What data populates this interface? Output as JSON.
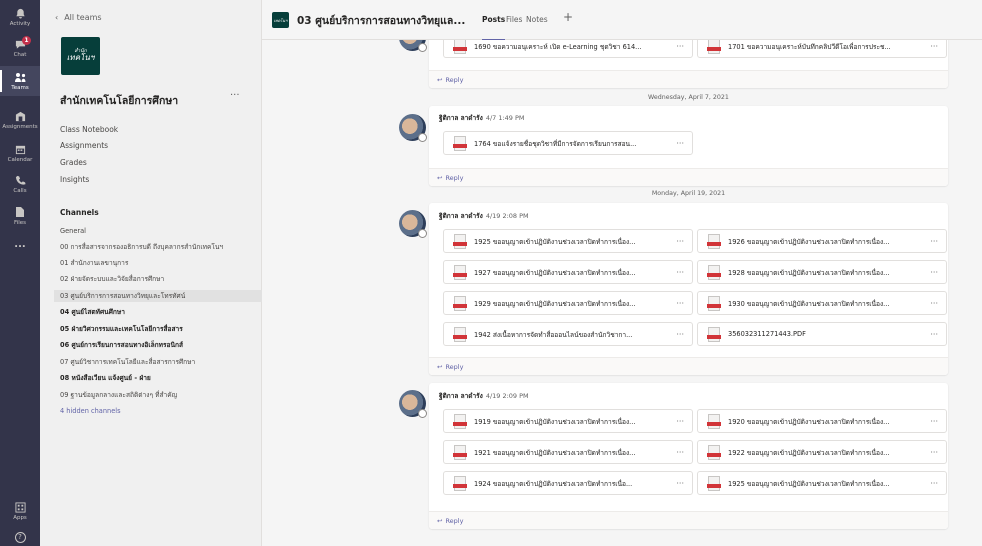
{
  "rail": [
    {
      "label": "Activity",
      "icon": "bell-icon"
    },
    {
      "label": "Chat",
      "icon": "chat-icon",
      "badge": "1"
    },
    {
      "label": "Teams",
      "icon": "teams-icon",
      "active": true
    },
    {
      "label": "Assignments",
      "icon": "assignments-icon"
    },
    {
      "label": "Calendar",
      "icon": "calendar-icon"
    },
    {
      "label": "Calls",
      "icon": "phone-icon"
    },
    {
      "label": "Files",
      "icon": "file-icon"
    },
    {
      "label": "...",
      "icon": "more-icon"
    },
    {
      "label": "Apps",
      "icon": "apps-icon"
    },
    {
      "label": "?",
      "icon": "help-icon"
    }
  ],
  "panel": {
    "back_label": "All teams",
    "logo_line1": "สำนัก",
    "logo_line2": "เทคโนฯ",
    "team_name": "สำนักเทคโนโลยีการศึกษา",
    "team_more": "···",
    "links": [
      "Class Notebook",
      "Assignments",
      "Grades",
      "Insights"
    ],
    "channels_heading": "Channels",
    "channels": [
      {
        "label": "General"
      },
      {
        "label": "00 การสื่อสารจากรองอธิการบดี ถึงบุคลากรสำนักเทคโนฯ"
      },
      {
        "label": "01 สำนักงานเลขานุการ"
      },
      {
        "label": "02 ฝ่ายจัดระบบและวิจัยสื่อการศึกษา"
      },
      {
        "label": "03 ศูนย์บริการการสอนทางวิทยุและโทรทัศน์",
        "selected": true
      },
      {
        "label": "04 ศูนย์ไสตทัศนศึกษา",
        "bold": true
      },
      {
        "label": "05 ฝ่ายวิศวกรรมและเทคโนโลยีการสื่อสาร",
        "bold": true
      },
      {
        "label": "06 ศูนย์การเรียนการสอนทางอิเล็กทรอนิกส์",
        "bold": true
      },
      {
        "label": "07 ศูนย์วิชาการเทคโนโลยีและสื่อสารการศึกษา"
      },
      {
        "label": "08 หนังสือเวียน แจ้งศูนย์ - ฝ่าย",
        "bold": true
      },
      {
        "label": "09 ฐานข้อมูลกลางและสถิติต่างๆ ที่สำคัญ"
      }
    ],
    "hidden_channels": "4 hidden channels"
  },
  "header": {
    "channel_icon_text": "เทคโนฯ",
    "title": "03 ศูนย์บริการการสอนทางวิทยุแล...",
    "tabs": [
      "Posts",
      "Files",
      "Notes"
    ],
    "add_tab": "+"
  },
  "feed": {
    "reply_label": "Reply",
    "top_files": [
      "1690 ขอความอนุเคราะห์ เปิด e-Learning ชุดวิชา 614...",
      "1701 ขอความอนุเคราะห์บันทึกคลิปวีดีโอเพื่อการประช..."
    ],
    "date1": "Wednesday, April 7, 2021",
    "post1": {
      "author": "ฐิติกาล ลาดำรัง",
      "time": "4/7 1:49 PM",
      "files": [
        "1764 ขอแจ้งรายชื่อชุดวิชาที่มีการจัดการเรียนการสอน..."
      ]
    },
    "date2": "Monday, April 19, 2021",
    "post2": {
      "author": "ฐิติกาล ลาดำรัง",
      "time": "4/19 2:08 PM",
      "files": [
        "1925 ขออนุญาตเข้าปฏิบัติงานช่วงเวลาปิดทำการเนื่อง...",
        "1926 ขออนุญาตเข้าปฏิบัติงานช่วงเวลาปิดทำการเนื่อง...",
        "1927 ขออนุญาตเข้าปฏิบัติงานช่วงเวลาปิดทำการเนื่อง...",
        "1928 ขออนุญาตเข้าปฏิบัติงานช่วงเวลาปิดทำการเนื่อง...",
        "1929 ขออนุญาตเข้าปฏิบัติงานช่วงเวลาปิดทำการเนื่อง...",
        "1930 ขออนุญาตเข้าปฏิบัติงานช่วงเวลาปิดทำการเนื่อง...",
        "1942 ส่งเนื้อหาการจัดทำสื่อออนไลน์ของสำนักวิชากา...",
        "356032311271443.PDF"
      ]
    },
    "post3": {
      "author": "ฐิติกาล ลาดำรัง",
      "time": "4/19 2:09 PM",
      "files": [
        "1919 ขออนุญาตเข้าปฏิบัติงานช่วงเวลาปิดทำการเนื่อง...",
        "1920 ขออนุญาตเข้าปฏิบัติงานช่วงเวลาปิดทำการเนื่อง...",
        "1921 ขออนุญาตเข้าปฏิบัติงานช่วงเวลาปิดทำการเนื่อง...",
        "1922 ขออนุญาตเข้าปฏิบัติงานช่วงเวลาปิดทำการเนื่อง...",
        "1924 ขออนุญาตเข้าปฏิบัติงานช่วงเวลาปิดทำการเนื่อ...",
        "1925 ขออนุญาตเข้าปฏิบัติงานช่วงเวลาปิดทำการเนื่อง..."
      ]
    },
    "file_more": "···"
  },
  "colors": {
    "rail": "#33344a",
    "accent": "#6264a7",
    "team_logo": "#063e3a",
    "badge": "#c4314b"
  }
}
